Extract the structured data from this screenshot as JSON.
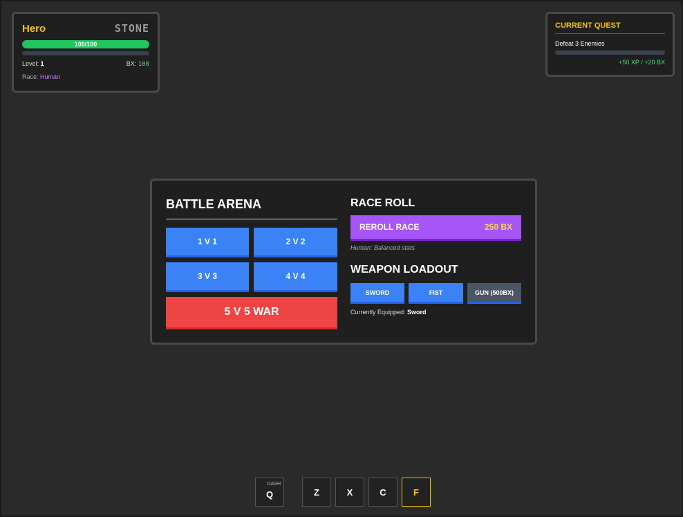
{
  "player": {
    "name": "Hero",
    "rank": "STONE",
    "hp_text": "100/100",
    "hp_fraction": 1.0,
    "xp_fraction": 0.0,
    "level_label": "Level: ",
    "level_value": "1",
    "bx_label": "BX: ",
    "bx_value": "100",
    "race_label": "Race: ",
    "race_value": "Human"
  },
  "quest": {
    "title": "CURRENT QUEST",
    "description": "Defeat 3 Enemies",
    "progress_fraction": 0.0,
    "reward": "+50 XP / +20 BX"
  },
  "arena": {
    "title": "BATTLE ARENA",
    "modes": [
      "1 V 1",
      "2 V 2",
      "3 V 3",
      "4 V 4"
    ],
    "war_label": "5 V 5 WAR"
  },
  "race_roll": {
    "title": "RACE ROLL",
    "button_label": "REROLL RACE",
    "price": "250 BX",
    "note": "Human: Balanced stats"
  },
  "weapons": {
    "title": "WEAPON LOADOUT",
    "sword": "SWORD",
    "fist": "FIST",
    "gun": "GUN (500BX)",
    "equipped_label": "Currently Equipped: ",
    "equipped_value": "Sword"
  },
  "hotbar": {
    "dash_label": "DASH",
    "keys": [
      "Q",
      "Z",
      "X",
      "C",
      "F"
    ]
  },
  "colors": {
    "accent_yellow": "#f5c400",
    "hp_green": "#22c55e",
    "blue_button": "#3b82f6",
    "red_button": "#ef4444",
    "purple_button": "#a855f7"
  }
}
